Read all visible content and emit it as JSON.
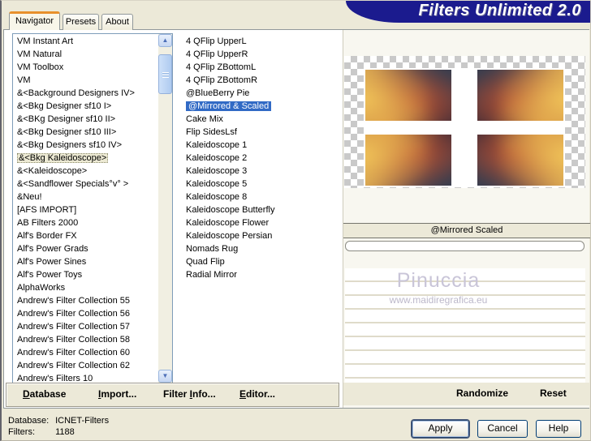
{
  "window": {
    "title": "Filters Unlimited 2.0"
  },
  "tabs": {
    "navigator": "Navigator",
    "presets": "Presets",
    "about": "About"
  },
  "category_list": {
    "selected": "&<Bkg Kaleidoscope>",
    "items": [
      "VM Instant Art",
      "VM Natural",
      "VM Toolbox",
      "VM",
      "&<Background Designers IV>",
      "&<Bkg Designer sf10 I>",
      "&<BKg Designer sf10 II>",
      "&<Bkg Designer sf10 III>",
      "&<Bkg Designers sf10 IV>",
      "&<Bkg Kaleidoscope>",
      "&<Kaleidoscope>",
      "&<Sandflower Specials°v° >",
      "&Neu!",
      "[AFS IMPORT]",
      "AB Filters 2000",
      "Alf's Border FX",
      "Alf's Power Grads",
      "Alf's Power Sines",
      "Alf's Power Toys",
      "AlphaWorks",
      "Andrew's Filter Collection 55",
      "Andrew's Filter Collection 56",
      "Andrew's Filter Collection 57",
      "Andrew's Filter Collection 58",
      "Andrew's Filter Collection 60",
      "Andrew's Filter Collection 62",
      "Andrew's Filters 10"
    ]
  },
  "filter_list": {
    "selected": "@Mirrored & Scaled",
    "items": [
      "4 QFlip UpperL",
      "4 QFlip UpperR",
      "4 QFlip ZBottomL",
      "4 QFlip ZBottomR",
      "@BlueBerry Pie",
      "@Mirrored & Scaled",
      "Cake Mix",
      "Flip SidesLsf",
      "Kaleidoscope 1",
      "Kaleidoscope 2",
      "Kaleidoscope 3",
      "Kaleidoscope 5",
      "Kaleidoscope 8",
      "Kaleidoscope Butterfly",
      "Kaleidoscope Flower",
      "Kaleidoscope Persian",
      "Nomads Rug",
      "Quad Flip",
      "Radial Mirror"
    ]
  },
  "preview": {
    "caption": "@Mirrored  Scaled",
    "watermark_name": "Pinuccia",
    "watermark_site": "www.maidiregrafica.eu",
    "randomize": "Randomize",
    "reset": "Reset"
  },
  "menu": {
    "items": [
      {
        "pre": "",
        "accel": "D",
        "post": "atabase"
      },
      {
        "pre": "",
        "accel": "I",
        "post": "mport..."
      },
      {
        "pre": "Filter ",
        "accel": "I",
        "post": "nfo..."
      },
      {
        "pre": "",
        "accel": "E",
        "post": "ditor..."
      }
    ]
  },
  "status": {
    "database_label": "Database:",
    "database_value": "ICNET-Filters",
    "filters_label": "Filters:",
    "filters_value": "1188"
  },
  "actions": {
    "apply": "Apply",
    "cancel": "Cancel",
    "help": "Help"
  },
  "icons": {
    "scroll_up": "▲",
    "scroll_down": "▼"
  },
  "colors": {
    "window_bg": "#ECE9D8",
    "banner": "#1B1B8E",
    "selection_blue": "#316AC5",
    "tab_accent": "#E8902C",
    "checker_gray": "#C9C9C9"
  }
}
